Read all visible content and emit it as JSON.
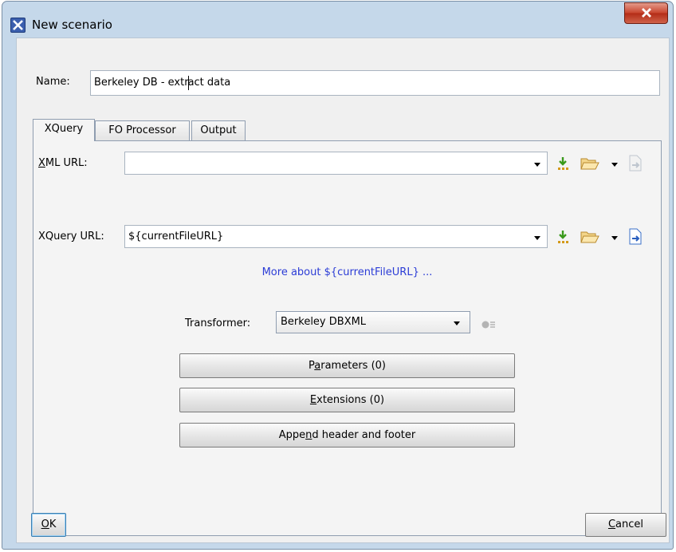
{
  "window": {
    "title": "New scenario",
    "app_icon": "oxygen-x-icon",
    "close_icon": "close-x-icon"
  },
  "name_field": {
    "label": "Name:",
    "value_before_caret": "Berkeley DB - extr",
    "value_after_caret": "act data"
  },
  "tabs": [
    {
      "label": "XQuery",
      "active": true
    },
    {
      "label": "FO Processor",
      "active": false
    },
    {
      "label": "Output",
      "active": false
    }
  ],
  "xquery_tab": {
    "xml_url": {
      "label_prefix": "X",
      "label_rest": "ML URL:",
      "value": ""
    },
    "xquery_url": {
      "label": "XQuery URL:",
      "value": "${currentFileURL}"
    },
    "more_link": "More about ${currentFileURL} ...",
    "transformer": {
      "label": "Transformer:",
      "value": "Berkeley DBXML"
    },
    "buttons": {
      "parameters": {
        "pre": "P",
        "mnemonic": "a",
        "post": "rameters (0)"
      },
      "extensions": {
        "pre": "",
        "mnemonic": "E",
        "post": "xtensions (0)"
      },
      "append": {
        "pre": "Appe",
        "mnemonic": "n",
        "post": "d header and footer"
      }
    }
  },
  "footer": {
    "ok": {
      "mnemonic": "O",
      "post": "K"
    },
    "cancel": {
      "mnemonic": "C",
      "post": "ancel"
    }
  },
  "icons": [
    "insert-editor-variables-icon",
    "open-folder-icon",
    "open-in-editor-icon",
    "gear-icon"
  ],
  "colors": {
    "link": "#2b3cd6",
    "client_bg": "#f0f0f0",
    "frame": "#c5d8ea",
    "close_button": "#c8432c"
  }
}
